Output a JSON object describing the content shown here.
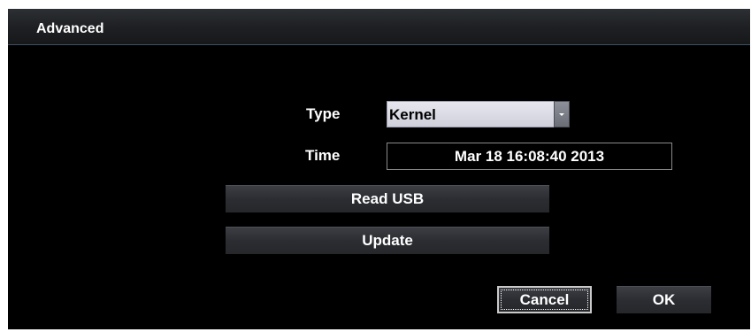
{
  "dialog": {
    "title": "Advanced"
  },
  "fields": {
    "type_label": "Type",
    "type_value": "Kernel",
    "time_label": "Time",
    "time_value": "Mar 18 16:08:40 2013"
  },
  "buttons": {
    "read_usb": "Read USB",
    "update": "Update",
    "cancel": "Cancel",
    "ok": "OK"
  },
  "icons": {
    "dropdown": "chevron-down-icon"
  }
}
